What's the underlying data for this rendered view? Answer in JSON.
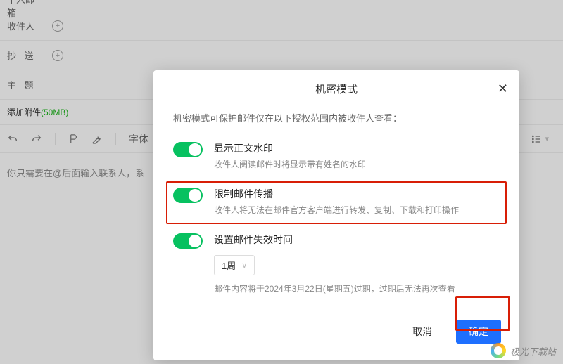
{
  "bg": {
    "top_label": "个人邮箱",
    "recipient_label": "收件人",
    "cc_label": "抄  送",
    "subject_label": "主  题",
    "attach_label": "添加附件",
    "attach_size": "(50MB)",
    "font_label": "字体",
    "placeholder_text": "你只需要在@后面输入联系人，系"
  },
  "dialog": {
    "title": "机密模式",
    "intro": "机密模式可保护邮件仅在以下授权范围内被收件人查看：",
    "opt1": {
      "title": "显示正文水印",
      "desc": "收件人阅读邮件时将显示带有姓名的水印"
    },
    "opt2": {
      "title": "限制邮件传播",
      "desc": "收件人将无法在邮件官方客户端进行转发、复制、下载和打印操作"
    },
    "opt3": {
      "title": "设置邮件失效时间",
      "select": "1周",
      "note": "邮件内容将于2024年3月22日(星期五)过期，过期后无法再次查看"
    },
    "cancel": "取消",
    "ok": "确定"
  },
  "watermark": "极光下载站"
}
